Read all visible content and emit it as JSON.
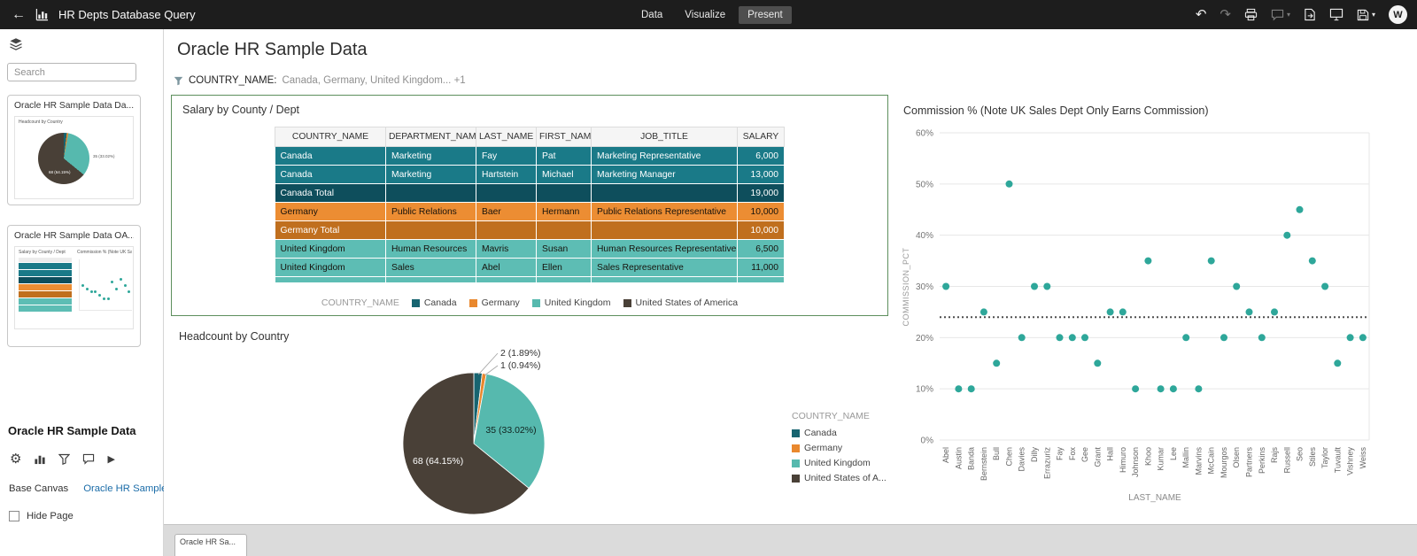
{
  "topbar": {
    "title": "HR Depts Database Query",
    "nav": {
      "data": "Data",
      "visualize": "Visualize",
      "present": "Present"
    },
    "avatar_initial": "W"
  },
  "sidebar": {
    "search_placeholder": "Search",
    "cards": [
      {
        "title": "Oracle HR Sample Data Da..."
      },
      {
        "title": "Oracle HR Sample Data OA..."
      }
    ],
    "dataset_title": "Oracle HR Sample Data",
    "base_canvas_label": "Base Canvas",
    "base_canvas_link": "Oracle HR Sample Data",
    "hide_page_label": "Hide Page"
  },
  "main": {
    "page_title": "Oracle HR Sample Data",
    "filter": {
      "field": "COUNTRY_NAME:",
      "value": "Canada, Germany, United Kingdom... +1"
    }
  },
  "footer": {
    "canvas_tab": "Oracle HR Sa..."
  },
  "chart_data": [
    {
      "type": "table",
      "title": "Salary by County / Dept",
      "columns": [
        "COUNTRY_NAME",
        "DEPARTMENT_NAME",
        "LAST_NAME",
        "FIRST_NAME",
        "JOB_TITLE",
        "SALARY"
      ],
      "rows": [
        {
          "type": "canada",
          "cells": [
            "Canada",
            "Marketing",
            "Fay",
            "Pat",
            "Marketing Representative",
            "6,000"
          ]
        },
        {
          "type": "canada",
          "cells": [
            "Canada",
            "Marketing",
            "Hartstein",
            "Michael",
            "Marketing Manager",
            "13,000"
          ]
        },
        {
          "type": "canada-total",
          "cells": [
            "Canada Total",
            "",
            "",
            "",
            "",
            "19,000"
          ]
        },
        {
          "type": "germany",
          "cells": [
            "Germany",
            "Public Relations",
            "Baer",
            "Hermann",
            "Public Relations Representative",
            "10,000"
          ]
        },
        {
          "type": "germany-total",
          "cells": [
            "Germany Total",
            "",
            "",
            "",
            "",
            "10,000"
          ]
        },
        {
          "type": "uk",
          "cells": [
            "United Kingdom",
            "Human Resources",
            "Mavris",
            "Susan",
            "Human Resources Representative",
            "6,500"
          ]
        },
        {
          "type": "uk",
          "cells": [
            "United Kingdom",
            "Sales",
            "Abel",
            "Ellen",
            "Sales Representative",
            "11,000"
          ]
        }
      ],
      "legend_title": "COUNTRY_NAME",
      "legend": [
        {
          "label": "Canada",
          "color": "#176470"
        },
        {
          "label": "Germany",
          "color": "#e9882e"
        },
        {
          "label": "United Kingdom",
          "color": "#56b9ae"
        },
        {
          "label": "United States of America",
          "color": "#494037"
        }
      ]
    },
    {
      "type": "pie",
      "title": "Headcount by Country",
      "legend_title": "COUNTRY_NAME",
      "categories": [
        "Canada",
        "Germany",
        "United Kingdom",
        "United States of America"
      ],
      "values": [
        2,
        1,
        35,
        68
      ],
      "labels": [
        "2 (1.89%)",
        "1 (0.94%)",
        "35 (33.02%)",
        "68 (64.15%)"
      ],
      "colors": [
        "#176470",
        "#e9882e",
        "#56b9ae",
        "#494037"
      ],
      "legend_display": [
        "Canada",
        "Germany",
        "United Kingdom",
        "United States of A..."
      ]
    },
    {
      "type": "scatter",
      "title": "Commission % (Note UK Sales Dept Only Earns Commission)",
      "xlabel": "LAST_NAME",
      "ylabel": "COMMISSION_PCT",
      "ylim": [
        0,
        60
      ],
      "y_tick_step": 10,
      "y_tick_suffix": "%",
      "trend_line_pct": 24,
      "dot_color": "#2ea79a",
      "x": [
        "Abel",
        "Austin",
        "Banda",
        "Bernstein",
        "Bull",
        "Chen",
        "Davies",
        "Dilly",
        "Errazuriz",
        "Fay",
        "Fox",
        "Gee",
        "Grant",
        "Hall",
        "Himuro",
        "Johnson",
        "Khoo",
        "Kumar",
        "Lee",
        "Mallin",
        "Marvins",
        "McCain",
        "Mourgos",
        "Olsen",
        "Partners",
        "Perkins",
        "Rajs",
        "Russell",
        "Seo",
        "Stiles",
        "Taylor",
        "Tuvault",
        "Vishney",
        "Weiss"
      ],
      "y": [
        30,
        10,
        10,
        25,
        15,
        50,
        20,
        30,
        30,
        20,
        20,
        20,
        15,
        25,
        25,
        10,
        35,
        10,
        10,
        20,
        10,
        35,
        20,
        30,
        25,
        20,
        25,
        40,
        45,
        35,
        30,
        15,
        20,
        20
      ]
    }
  ]
}
